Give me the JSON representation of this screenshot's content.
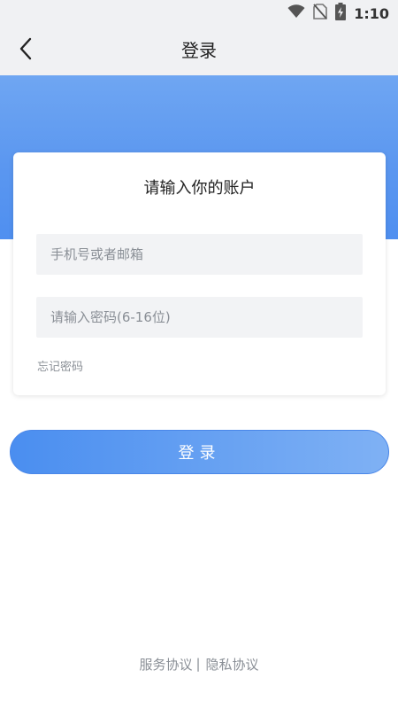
{
  "status_bar": {
    "time": "1:10",
    "icons": [
      "wifi-icon",
      "no-sim-icon",
      "battery-charging-icon"
    ]
  },
  "header": {
    "title": "登录",
    "back_icon": "chevron-left-icon"
  },
  "login_card": {
    "title": "请输入你的账户",
    "account_placeholder": "手机号或者邮箱",
    "account_value": "",
    "password_placeholder": "请输入密码(6-16位)",
    "password_value": "",
    "forgot_password": "忘记密码"
  },
  "login_button": {
    "label": "登录"
  },
  "footer": {
    "service_agreement": "服务协议",
    "separator": "|",
    "privacy_agreement": "隐私协议"
  },
  "colors": {
    "accent": "#4f8ff0",
    "hero_top": "#6fa6f2",
    "button_start": "#4a8ef0",
    "button_end": "#7fb1f4",
    "bar_background": "#f0f1f3",
    "muted_text": "#8a8f96"
  }
}
